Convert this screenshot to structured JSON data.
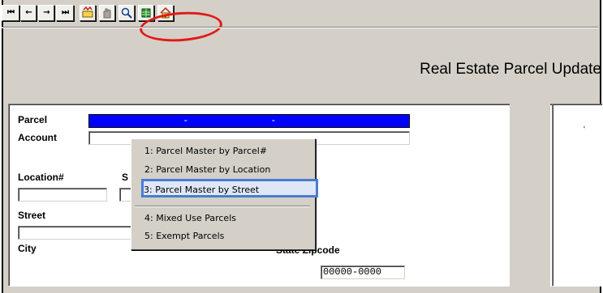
{
  "toolbar": {
    "first": "⏮",
    "prev": "←",
    "next": "→",
    "last": "⏭",
    "icons": [
      "first-record-icon",
      "previous-record-icon",
      "next-record-icon",
      "last-record-icon",
      "update-icon",
      "disabled-hand-icon",
      "magnifier-lookup-icon",
      "spreadsheet-icon",
      "home-icon"
    ]
  },
  "page": {
    "title": "Real Estate Parcel Update"
  },
  "form": {
    "parcel_label": "Parcel",
    "parcel_value": "                -              -",
    "account_label": "Account",
    "location_label": "Location#",
    "s_label": "S",
    "street_label": "Street",
    "city_label": "City",
    "state_zip_label": "State Zipcode",
    "zipcode_value": "00000-0000"
  },
  "menu": {
    "items": [
      "1: Parcel Master by Parcel#",
      "2: Parcel Master by Location",
      "3: Parcel Master by Street",
      "4: Mixed Use Parcels",
      "5: Exempt Parcels"
    ],
    "highlight_color": "#4a7bd3"
  },
  "annotation": {
    "circle_color": "#e21a1a"
  },
  "right_panel": {
    "mark": "'"
  }
}
